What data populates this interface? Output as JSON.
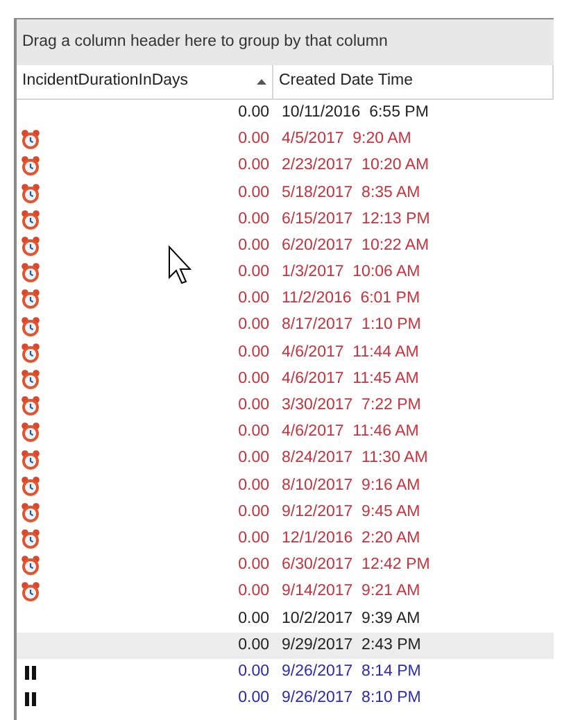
{
  "group_panel": {
    "text": "Drag a column header here to group by that column"
  },
  "columns": [
    {
      "label": "IncidentDurationInDays",
      "sorted": true
    },
    {
      "label": "Created Date Time",
      "sorted": false
    }
  ],
  "rows": [
    {
      "kind": "normal",
      "selected": false,
      "duration": "0.00",
      "created": "10/11/2016  6:55 PM"
    },
    {
      "kind": "overdue",
      "selected": false,
      "duration": "0.00",
      "created": "4/5/2017  9:20 AM"
    },
    {
      "kind": "overdue",
      "selected": false,
      "duration": "0.00",
      "created": "2/23/2017  10:20 AM"
    },
    {
      "kind": "overdue",
      "selected": false,
      "duration": "0.00",
      "created": "5/18/2017  8:35 AM"
    },
    {
      "kind": "overdue",
      "selected": false,
      "duration": "0.00",
      "created": "6/15/2017  12:13 PM"
    },
    {
      "kind": "overdue",
      "selected": false,
      "duration": "0.00",
      "created": "6/20/2017  10:22 AM"
    },
    {
      "kind": "overdue",
      "selected": false,
      "duration": "0.00",
      "created": "1/3/2017  10:06 AM"
    },
    {
      "kind": "overdue",
      "selected": false,
      "duration": "0.00",
      "created": "11/2/2016  6:01 PM"
    },
    {
      "kind": "overdue",
      "selected": false,
      "duration": "0.00",
      "created": "8/17/2017  1:10 PM"
    },
    {
      "kind": "overdue",
      "selected": false,
      "duration": "0.00",
      "created": "4/6/2017  11:44 AM"
    },
    {
      "kind": "overdue",
      "selected": false,
      "duration": "0.00",
      "created": "4/6/2017  11:45 AM"
    },
    {
      "kind": "overdue",
      "selected": false,
      "duration": "0.00",
      "created": "3/30/2017  7:22 PM"
    },
    {
      "kind": "overdue",
      "selected": false,
      "duration": "0.00",
      "created": "4/6/2017  11:46 AM"
    },
    {
      "kind": "overdue",
      "selected": false,
      "duration": "0.00",
      "created": "8/24/2017  11:30 AM"
    },
    {
      "kind": "overdue",
      "selected": false,
      "duration": "0.00",
      "created": "8/10/2017  9:16 AM"
    },
    {
      "kind": "overdue",
      "selected": false,
      "duration": "0.00",
      "created": "9/12/2017  9:45 AM"
    },
    {
      "kind": "overdue",
      "selected": false,
      "duration": "0.00",
      "created": "12/1/2016  2:20 AM"
    },
    {
      "kind": "overdue",
      "selected": false,
      "duration": "0.00",
      "created": "6/30/2017  12:42 PM"
    },
    {
      "kind": "overdue",
      "selected": false,
      "duration": "0.00",
      "created": "9/14/2017  9:21 AM"
    },
    {
      "kind": "normal",
      "selected": false,
      "duration": "0.00",
      "created": "10/2/2017  9:39 AM"
    },
    {
      "kind": "normal",
      "selected": true,
      "duration": "0.00",
      "created": "9/29/2017  2:43 PM"
    },
    {
      "kind": "paused",
      "selected": false,
      "duration": "0.00",
      "created": "9/26/2017  8:14 PM"
    },
    {
      "kind": "paused",
      "selected": false,
      "duration": "0.00",
      "created": "9/26/2017  8:10 PM"
    }
  ]
}
